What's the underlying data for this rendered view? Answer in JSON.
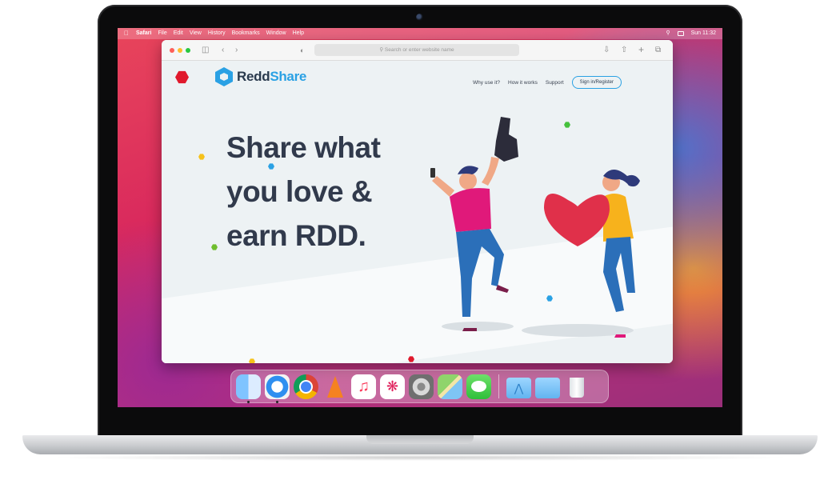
{
  "menubar": {
    "apple": "",
    "app_name": "Safari",
    "items": [
      "File",
      "Edit",
      "View",
      "History",
      "Bookmarks",
      "Window",
      "Help"
    ],
    "clock": "Sun 11:32"
  },
  "browser": {
    "address_placeholder": "Search or enter website name"
  },
  "site": {
    "brand_part1": "Redd",
    "brand_part2": "Share",
    "nav": [
      "Why use it?",
      "How it works",
      "Support"
    ],
    "signin_label": "Sign in/Register",
    "headline": [
      "Share what",
      "you love &",
      "earn RDD."
    ]
  },
  "colors": {
    "brand_blue": "#2aa1e4",
    "headline": "#313a4c",
    "accent_red": "#e0192c"
  },
  "dock": {
    "apps": [
      {
        "name": "finder-icon",
        "running": true
      },
      {
        "name": "safari-icon",
        "running": true
      },
      {
        "name": "chrome-icon",
        "running": false
      },
      {
        "name": "vlc-icon",
        "running": false
      },
      {
        "name": "music-icon",
        "running": false
      },
      {
        "name": "slack-icon",
        "running": false
      },
      {
        "name": "system-preferences-icon",
        "running": false
      },
      {
        "name": "maps-icon",
        "running": false
      },
      {
        "name": "messages-icon",
        "running": false
      }
    ],
    "folders": [
      "applications-folder-icon",
      "folder-icon",
      "trash-icon"
    ]
  }
}
